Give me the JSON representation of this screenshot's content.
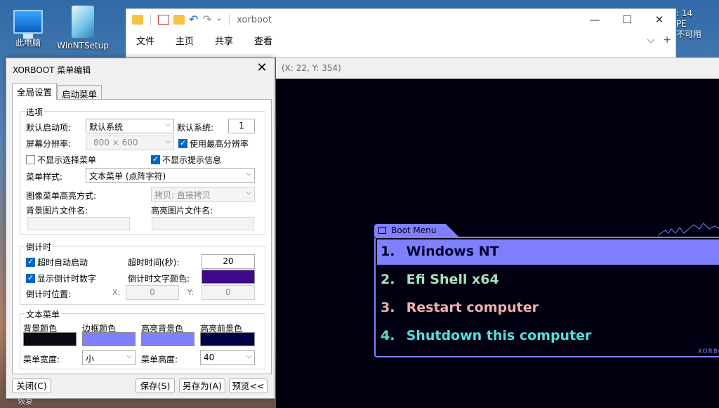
{
  "desktop": {
    "icons": [
      {
        "label": "此电脑"
      },
      {
        "label": "WinNTSetup"
      }
    ],
    "bottom_text": "恢复"
  },
  "explorer": {
    "title": "xorboot",
    "ribbon": [
      "文件",
      "主页",
      "共享",
      "查看"
    ],
    "controls": {
      "minimize": "—",
      "maximize": "☐",
      "close": "✕"
    },
    "chevron": "⌵",
    "plus": "+"
  },
  "tray": {
    "lines": [
      ": 14",
      "PE",
      "不可用"
    ]
  },
  "dialog": {
    "title": "XORBOOT 菜单编辑",
    "close": "✕",
    "tabs": [
      {
        "label": "全局设置",
        "active": true
      },
      {
        "label": "启动菜单",
        "active": false
      }
    ],
    "options": {
      "group_title": "选项",
      "default_boot_label": "默认启动项:",
      "default_boot_value": "默认系统",
      "default_system_label": "默认系统:",
      "default_system_value": "1",
      "resolution_label": "屏幕分辨率:",
      "resolution_value": "800 × 600",
      "use_max_resolution": {
        "label": "使用最高分辨率",
        "checked": true
      },
      "hide_select_menu": {
        "label": "不显示选择菜单",
        "checked": false
      },
      "hide_hint_info": {
        "label": "不显示提示信息",
        "checked": true
      },
      "menu_style_label": "菜单样式:",
      "menu_style_value": "文本菜单 (点阵字符)",
      "image_highlight_label": "图像菜单高亮方式:",
      "image_highlight_value": "拷贝: 直接拷贝",
      "bg_image_label": "背景图片文件名:",
      "hl_image_label": "高亮图片文件名:"
    },
    "countdown": {
      "group_title": "倒计时",
      "auto_boot_timeout": {
        "label": "超时自动启动",
        "checked": true
      },
      "timeout_label": "超时时间(秒):",
      "timeout_value": "20",
      "show_countdown": {
        "label": "显示倒计时数字",
        "checked": true
      },
      "text_color_label": "倒计时文字颜色:",
      "text_color": "#3d0a8a",
      "position_label": "倒计时位置:",
      "x_label": "X:",
      "x_value": "0",
      "y_label": "Y:",
      "y_value": "0"
    },
    "text_menu": {
      "group_title": "文本菜单",
      "bg_color_label": "背景颜色",
      "bg_color": "#0a0a12",
      "border_color_label": "边框颜色",
      "border_color": "#8080ff",
      "hl_bg_label": "高亮背景色",
      "hl_bg_color": "#8080ff",
      "hl_fg_label": "高亮前景色",
      "hl_fg_color": "#000045",
      "width_label": "菜单宽度:",
      "width_value": "小",
      "height_label": "菜单高度:",
      "height_value": "40"
    },
    "buttons": {
      "close": "关闭(C)",
      "save": "保存(S)",
      "save_as": "另存为(A)",
      "preview": "预览<<"
    }
  },
  "preview": {
    "coords": "(X: 22, Y: 354)",
    "menu_title": "Boot Menu",
    "brand": "XORBO",
    "items": [
      {
        "num": "1.",
        "label": "Windows NT",
        "color": "#000030",
        "highlighted": true
      },
      {
        "num": "2.",
        "label": "Efi Shell x64",
        "color": "#a8e0c0"
      },
      {
        "num": "3.",
        "label": "Restart computer",
        "color": "#f0b0b0"
      },
      {
        "num": "4.",
        "label": "Shutdown this computer",
        "color": "#50e0e0"
      }
    ]
  }
}
